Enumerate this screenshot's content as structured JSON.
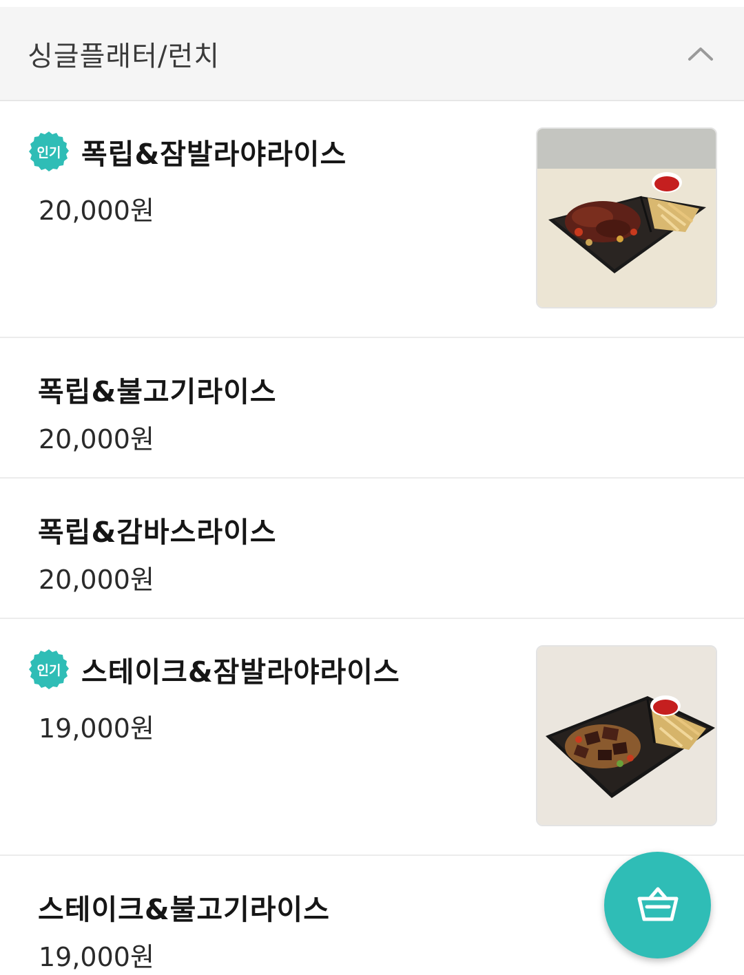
{
  "category": {
    "title": "싱글플래터/런치",
    "toggle_icon": "chevron-up-icon"
  },
  "menu": {
    "items": [
      {
        "name": "폭립&잠발라야라이스",
        "price": "20,000원",
        "badge": "인기",
        "has_image": true
      },
      {
        "name": "폭립&불고기라이스",
        "price": "20,000원",
        "badge": null,
        "has_image": false
      },
      {
        "name": "폭립&감바스라이스",
        "price": "20,000원",
        "badge": null,
        "has_image": false
      },
      {
        "name": "스테이크&잠발라야라이스",
        "price": "19,000원",
        "badge": "인기",
        "has_image": true
      },
      {
        "name": "스테이크&불고기라이스",
        "price": "19,000원",
        "badge": null,
        "has_image": false
      }
    ]
  },
  "cart": {
    "icon": "basket-icon"
  },
  "colors": {
    "accent": "#2fbdb6",
    "header_bg": "#f5f5f5",
    "divider": "#ececec"
  }
}
